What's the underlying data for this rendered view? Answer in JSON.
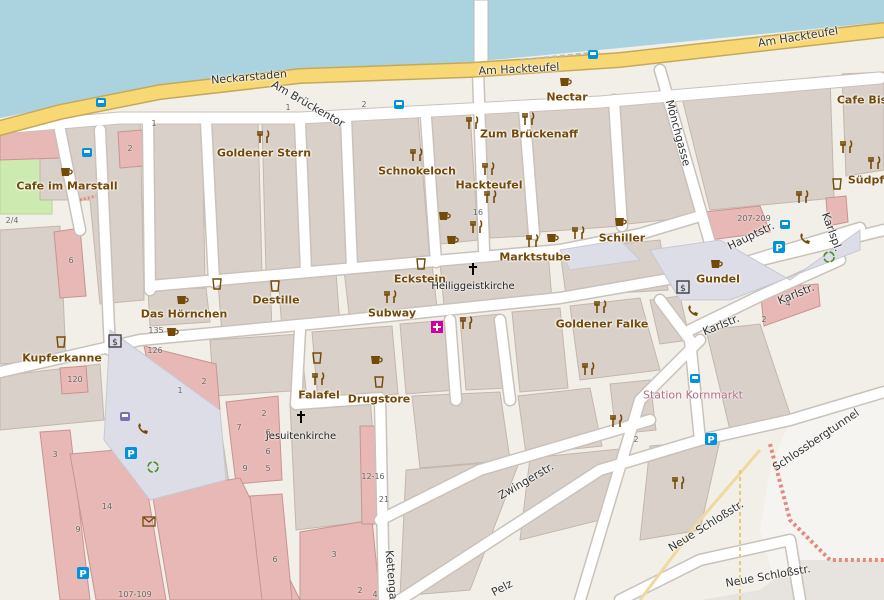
{
  "colors": {
    "water": "#aad3df",
    "land": "#f2efe9",
    "building": "#d9d0c9",
    "building_pink": "#e7b8b5",
    "primary_road": "#f8d775",
    "road": "#ffffff",
    "poi_text": "#734a08"
  },
  "pois": [
    {
      "label": "Goldener Stern",
      "icon": "restaurant-icon"
    },
    {
      "label": "Cafe im Marstall",
      "icon": "cafe-icon"
    },
    {
      "label": "Schnokeloch",
      "icon": "restaurant-icon"
    },
    {
      "label": "Zum Brückenaff",
      "icon": "restaurant-icon"
    },
    {
      "label": "Nectar",
      "icon": "cafe-icon"
    },
    {
      "label": "Hackteufel",
      "icon": "restaurant-icon"
    },
    {
      "label": "Cafe Bis",
      "icon": "cafe-icon"
    },
    {
      "label": "Südpf",
      "icon": "fastfood-icon"
    },
    {
      "label": "Schiller",
      "icon": "cafe-icon"
    },
    {
      "label": "Marktstube",
      "icon": "restaurant-icon"
    },
    {
      "label": "Gundel",
      "icon": "cafe-icon"
    },
    {
      "label": "Eckstein",
      "icon": "fastfood-icon"
    },
    {
      "label": "Destille",
      "icon": "fastfood-icon"
    },
    {
      "label": "Das Hörnchen",
      "icon": "cafe-icon"
    },
    {
      "label": "Subway",
      "icon": "restaurant-icon"
    },
    {
      "label": "Goldener Falke",
      "icon": "restaurant-icon"
    },
    {
      "label": "Kupferkanne",
      "icon": "fastfood-icon"
    },
    {
      "label": "Falafel",
      "icon": "restaurant-icon"
    },
    {
      "label": "Drugstore",
      "icon": "fastfood-icon"
    }
  ],
  "places": [
    {
      "label": "Heiliggeistkirche",
      "icon": "church-icon"
    },
    {
      "label": "Jesuitenkirche",
      "icon": "church-icon"
    }
  ],
  "transport": [
    {
      "label": "Station Kornmarkt",
      "icon": "bus-stop-icon"
    }
  ],
  "streets": [
    {
      "label": "Neckarstaden"
    },
    {
      "label": "Am Hackteufel"
    },
    {
      "label": "Am Hackteufel"
    },
    {
      "label": "Am Brückentor"
    },
    {
      "label": "Mönchgasse"
    },
    {
      "label": "Hauptstr."
    },
    {
      "label": "Karlspl."
    },
    {
      "label": "Karlstr."
    },
    {
      "label": "Karlstr."
    },
    {
      "label": "Zwingerstr."
    },
    {
      "label": "Neue Schloßstr."
    },
    {
      "label": "Neue Schloßstr."
    },
    {
      "label": "Schlossbergtunnel"
    },
    {
      "label": "Kettengasse"
    },
    {
      "label": "Pelz"
    }
  ],
  "housenumbers": [
    "1",
    "2",
    "2/4",
    "6",
    "1",
    "2",
    "16",
    "207-209",
    "2",
    "4",
    "135",
    "126",
    "120",
    "1",
    "2",
    "2",
    "7",
    "6",
    "6",
    "9",
    "5",
    "3",
    "14",
    "9",
    "107-109",
    "6",
    "3",
    "4",
    "12-16",
    "21",
    "2",
    "2"
  ]
}
